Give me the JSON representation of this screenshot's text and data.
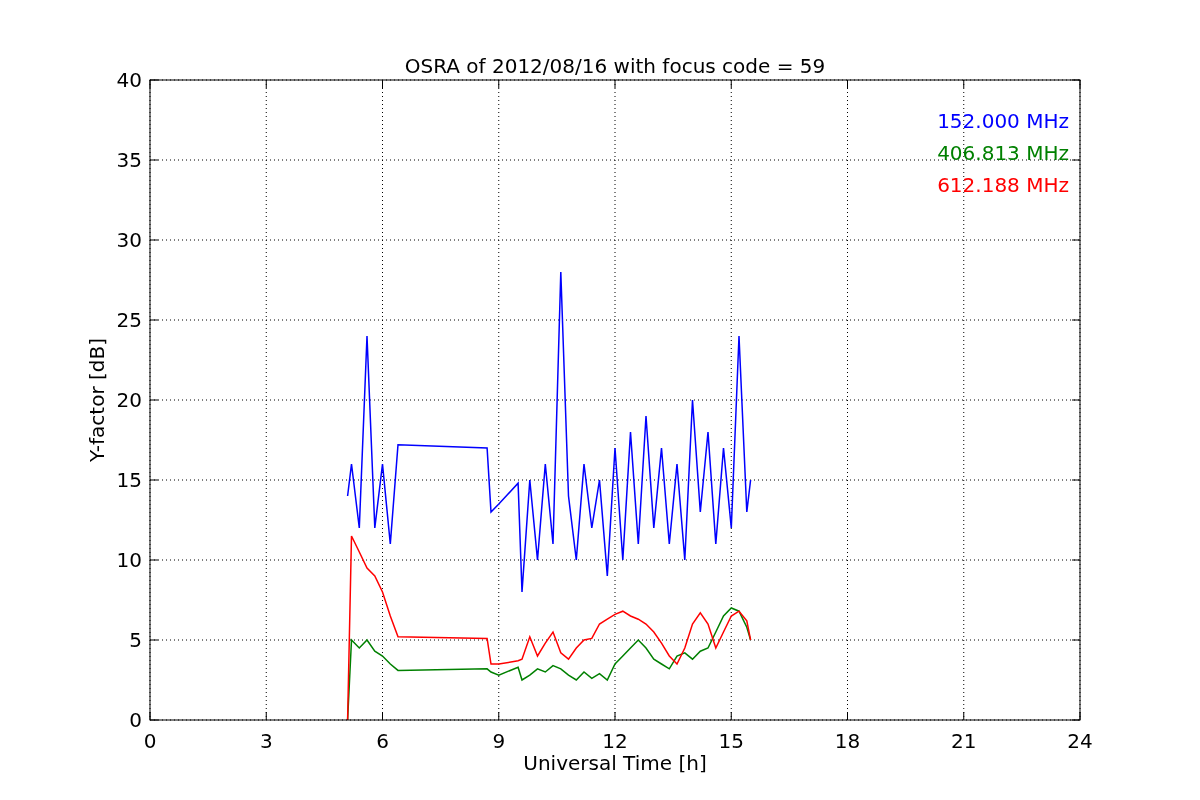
{
  "figure": {
    "chart_data": {
      "type": "line",
      "title": "OSRA of 2012/08/16 with focus code = 59",
      "xlabel": "Universal Time [h]",
      "ylabel": "Y-factor [dB]",
      "x": [
        5.1,
        5.2,
        5.4,
        5.6,
        5.8,
        6.0,
        6.2,
        6.4,
        8.7,
        8.8,
        9.0,
        9.5,
        9.6,
        9.8,
        10.0,
        10.2,
        10.4,
        10.6,
        10.8,
        11.0,
        11.2,
        11.4,
        11.6,
        11.8,
        12.0,
        12.2,
        12.4,
        12.6,
        12.8,
        13.0,
        13.2,
        13.4,
        13.6,
        13.8,
        14.0,
        14.2,
        14.4,
        14.6,
        14.8,
        15.0,
        15.2,
        15.4,
        15.5
      ],
      "series": [
        {
          "name": "152.000 MHz",
          "color": "#0000ff",
          "values": [
            14,
            16,
            12,
            24,
            12,
            16,
            11,
            17.2,
            17,
            13,
            13.5,
            14.8,
            8,
            15,
            10,
            16,
            11,
            28,
            14,
            10,
            16,
            12,
            15,
            9,
            17,
            10,
            18,
            11,
            19,
            12,
            17,
            11,
            16,
            10,
            20,
            13,
            18,
            11,
            17,
            12,
            24,
            13,
            15
          ]
        },
        {
          "name": "406.813 MHz",
          "color": "#008000",
          "values": [
            0,
            5,
            4.5,
            5,
            4.3,
            4,
            3.5,
            3.1,
            3.2,
            3,
            2.8,
            3.3,
            2.5,
            2.8,
            3.2,
            3,
            3.4,
            3.2,
            2.8,
            2.5,
            3,
            2.6,
            2.9,
            2.5,
            3.5,
            4,
            4.5,
            5,
            4.5,
            3.8,
            3.5,
            3.2,
            4,
            4.2,
            3.8,
            4.3,
            4.5,
            5.5,
            6.5,
            7,
            6.8,
            5.8,
            5
          ]
        },
        {
          "name": "612.188 MHz",
          "color": "#ff0000",
          "values": [
            0,
            11.5,
            10.5,
            9.5,
            9,
            8,
            6.5,
            5.2,
            5.1,
            3.5,
            3.5,
            3.7,
            3.8,
            5.2,
            4,
            4.8,
            5.5,
            4.2,
            3.8,
            4.5,
            5,
            5.1,
            6,
            6.3,
            6.6,
            6.8,
            6.5,
            6.3,
            6,
            5.5,
            4.8,
            4,
            3.5,
            4.5,
            6,
            6.7,
            6,
            4.5,
            5.5,
            6.5,
            6.8,
            6.2,
            5
          ]
        }
      ],
      "grid": true,
      "xlim": [
        0,
        24
      ],
      "ylim": [
        0,
        40
      ],
      "xticks": [
        0,
        3,
        6,
        9,
        12,
        15,
        18,
        21,
        24
      ],
      "yticks": [
        0,
        5,
        10,
        15,
        20,
        25,
        30,
        35,
        40
      ]
    }
  }
}
